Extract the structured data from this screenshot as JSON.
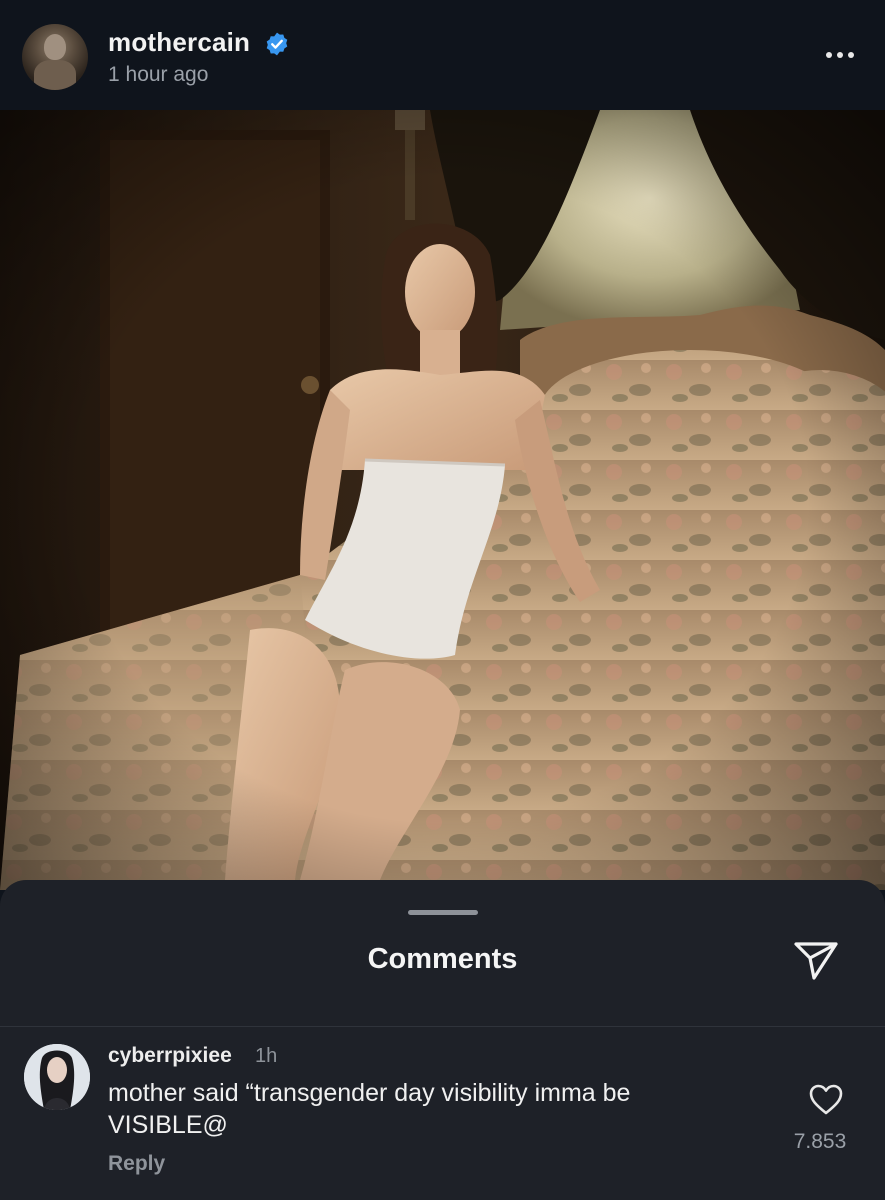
{
  "post": {
    "username": "mothercain",
    "timestamp": "1 hour ago",
    "verified_color": "#3897f0"
  },
  "comments_sheet": {
    "title": "Comments",
    "comments": [
      {
        "username": "cyberrpixiee",
        "time": "1h",
        "text": "mother said “transgender day visibility imma be VISIBLE@",
        "reply_label": "Reply",
        "like_count": "7.853"
      }
    ]
  },
  "icons": {
    "more": "more-horizontal-icon",
    "verified": "verified-badge-icon",
    "share": "send-icon",
    "like": "heart-outline-icon"
  }
}
